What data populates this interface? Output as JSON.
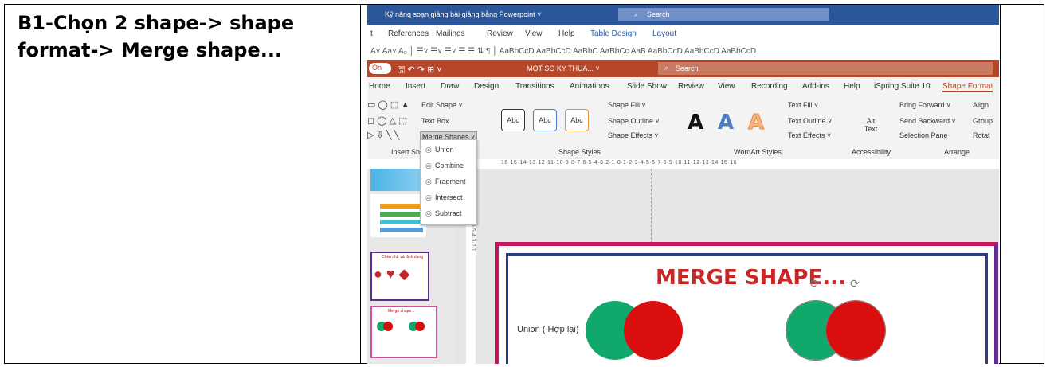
{
  "instruction": {
    "line1": "B1-Chọn 2 shape-> shape",
    "line2": "format-> Merge shape..."
  },
  "word_titlebar": {
    "doc_title": "Kỹ năng soạn giảng bài giảng bằng Powerpoint ˅",
    "search": "Search"
  },
  "word_tabs": [
    "t",
    "References",
    "Mailings",
    "Review",
    "View",
    "Help",
    "Table Design",
    "Layout"
  ],
  "ppt_titlebar": {
    "doc_title": "MOT SO KY THUA... ˅",
    "search": "Search",
    "autosave": "On"
  },
  "ppt_tabs": [
    "Home",
    "Insert",
    "Draw",
    "Design",
    "Transitions",
    "Animations",
    "Slide Show",
    "Review",
    "View",
    "Recording",
    "Add-ins",
    "Help",
    "iSpring Suite 10",
    "Shape Format"
  ],
  "ribbon": {
    "edit_shape": "Edit Shape ˅",
    "text_box": "Text Box",
    "merge_shapes": "Merge Shapes ˅",
    "insert_shapes_group": "Insert Sha",
    "shape_styles_group": "Shape Styles",
    "abc": "Abc",
    "shape_fill": "Shape Fill ˅",
    "shape_outline": "Shape Outline ˅",
    "shape_effects": "Shape Effects ˅",
    "wordart_letter": "A",
    "text_fill": "Text Fill ˅",
    "text_outline": "Text Outline ˅",
    "text_effects": "Text Effects ˅",
    "wordart_group": "WordArt Styles",
    "alt_text": "Alt Text",
    "accessibility_group": "Accessibility",
    "bring_forward": "Bring Forward ˅",
    "send_backward": "Send Backward ˅",
    "selection_pane": "Selection Pane",
    "align": "Align",
    "group": "Group",
    "rotate": "Rotat",
    "arrange_group": "Arrange"
  },
  "merge_menu": [
    "Union",
    "Combine",
    "Fragment",
    "Intersect",
    "Subtract"
  ],
  "ruler_text": "16·15·14·13·12·11·10·9·8·7·6·5·4·3·2·1·0·1·2·3·4·5·6·7·8·9·10·11·12·13·14·15·16",
  "slide": {
    "title": "MERGE SHAPE...",
    "label": "Union ( Hợp lại)"
  },
  "thumb": {
    "title_small": "Chèn chữ và định dạng",
    "title_small2": "Merge shape..."
  },
  "colors": {
    "green": "#11a86b",
    "red": "#d90f0f",
    "word_blue": "#2b579a",
    "ppt_red": "#b7472a"
  }
}
